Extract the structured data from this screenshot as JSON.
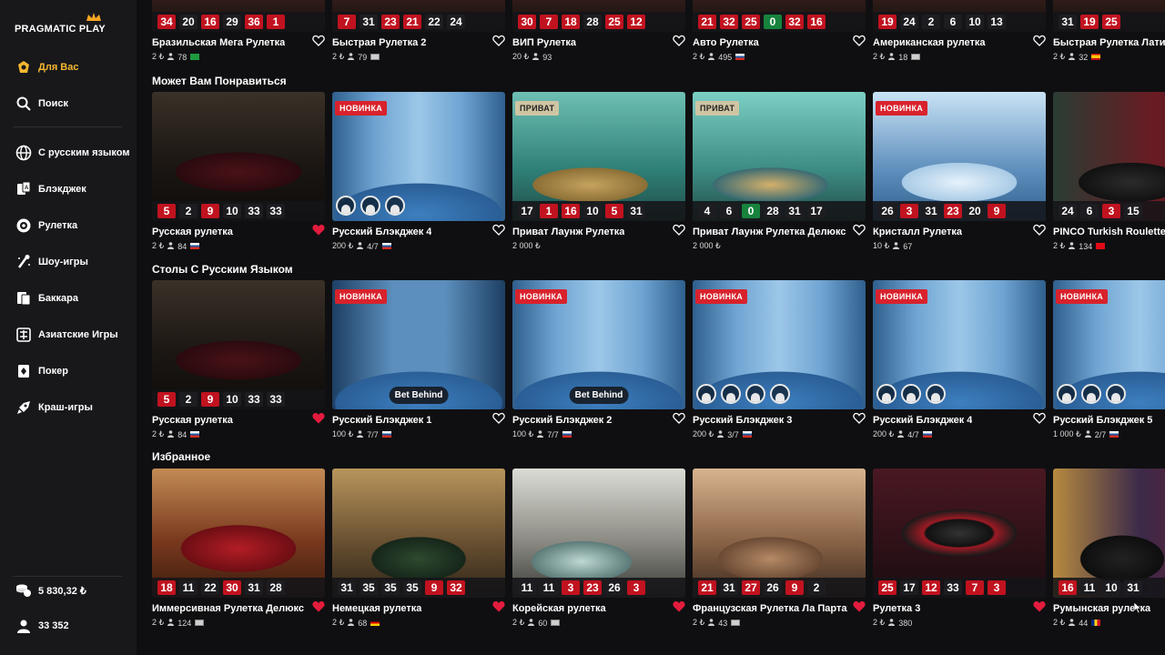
{
  "brand": {
    "logo_text": "PRAGMATIC PLAY"
  },
  "sidebar": {
    "items": [
      {
        "label": "Для Вас",
        "icon": "for-you-icon",
        "active": true
      },
      {
        "label": "Поиск",
        "icon": "search-icon"
      },
      {
        "label": "С русским языком",
        "icon": "globe-icon"
      },
      {
        "label": "Блэкджек",
        "icon": "blackjack-icon"
      },
      {
        "label": "Рулетка",
        "icon": "roulette-icon"
      },
      {
        "label": "Шоу-игры",
        "icon": "show-games-icon"
      },
      {
        "label": "Баккара",
        "icon": "baccarat-icon"
      },
      {
        "label": "Азиатские Игры",
        "icon": "asian-games-icon"
      },
      {
        "label": "Покер",
        "icon": "poker-icon"
      },
      {
        "label": "Краш-игры",
        "icon": "crash-games-icon"
      }
    ],
    "balance": "5 830,32 ₺",
    "players": "33 352"
  },
  "sections": [
    {
      "title": "",
      "cards": [
        {
          "name": "Бразильская Мега Рулетка",
          "bet": "2 ₺",
          "count": "78",
          "flag": "br",
          "nums": [
            [
              "34",
              "red"
            ],
            [
              "20",
              "blk"
            ],
            [
              "16",
              "red"
            ],
            [
              "29",
              "blk"
            ],
            [
              "36",
              "red"
            ],
            [
              "1",
              "red"
            ]
          ],
          "liked": false
        },
        {
          "name": "Быстрая Рулетка 2",
          "bet": "2 ₺",
          "count": "79",
          "flag": "gen",
          "nums": [
            [
              "7",
              "red"
            ],
            [
              "31",
              "blk"
            ],
            [
              "23",
              "red"
            ],
            [
              "21",
              "red"
            ],
            [
              "22",
              "blk"
            ],
            [
              "24",
              "blk"
            ]
          ],
          "liked": false
        },
        {
          "name": "ВИП Рулетка",
          "bet": "20 ₺",
          "count": "93",
          "flag": "",
          "nums": [
            [
              "30",
              "red"
            ],
            [
              "7",
              "red"
            ],
            [
              "18",
              "red"
            ],
            [
              "28",
              "blk"
            ],
            [
              "25",
              "red"
            ],
            [
              "12",
              "red"
            ]
          ],
          "liked": false
        },
        {
          "name": "Авто Рулетка",
          "bet": "2 ₺",
          "count": "495",
          "flag": "ru",
          "nums": [
            [
              "21",
              "red"
            ],
            [
              "32",
              "red"
            ],
            [
              "25",
              "red"
            ],
            [
              "0",
              "grn"
            ],
            [
              "32",
              "red"
            ],
            [
              "16",
              "red"
            ]
          ],
          "liked": false
        },
        {
          "name": "Американская рулетка",
          "bet": "2 ₺",
          "count": "18",
          "flag": "gen",
          "nums": [
            [
              "19",
              "red"
            ],
            [
              "24",
              "blk"
            ],
            [
              "2",
              "blk"
            ],
            [
              "6",
              "blk"
            ],
            [
              "10",
              "blk"
            ],
            [
              "13",
              "blk"
            ]
          ],
          "liked": false
        },
        {
          "name": "Быстрая Рулетка Латино",
          "bet": "2 ₺",
          "count": "32",
          "flag": "es",
          "nums": [
            [
              "31",
              "blk"
            ],
            [
              "19",
              "red"
            ],
            [
              "25",
              "red"
            ]
          ],
          "liked": false
        }
      ]
    },
    {
      "title": "Может Вам Понравиться",
      "cards": [
        {
          "name": "Русская рулетка",
          "bet": "2 ₺",
          "count": "84",
          "flag": "ru",
          "nums": [
            [
              "5",
              "red"
            ],
            [
              "2",
              "blk"
            ],
            [
              "9",
              "red"
            ],
            [
              "10",
              "blk"
            ],
            [
              "33",
              "blk"
            ],
            [
              "33",
              "blk"
            ]
          ],
          "liked": true,
          "scene": "roulette-dark"
        },
        {
          "name": "Русский Блэкджек 4",
          "bet": "200 ₺",
          "count": "4/7",
          "flag": "ru",
          "badge": "НОВИНКА",
          "seats": 3,
          "liked": false,
          "scene": "bj-blue"
        },
        {
          "name": "Приват Лаунж Рулетка",
          "bet": "2 000 ₺",
          "count": "",
          "flag": "",
          "badge_priv": "ПРИВАТ",
          "nums": [
            [
              "17",
              "blk"
            ],
            [
              "1",
              "red"
            ],
            [
              "16",
              "red"
            ],
            [
              "10",
              "blk"
            ],
            [
              "5",
              "red"
            ],
            [
              "31",
              "blk"
            ]
          ],
          "liked": false,
          "scene": "teal"
        },
        {
          "name": "Приват Лаунж Рулетка Делюкс",
          "bet": "2 000 ₺",
          "count": "",
          "flag": "",
          "badge_priv": "ПРИВАТ",
          "nums": [
            [
              "4",
              "blk"
            ],
            [
              "6",
              "blk"
            ],
            [
              "0",
              "grn"
            ],
            [
              "28",
              "blk"
            ],
            [
              "31",
              "blk"
            ],
            [
              "17",
              "blk"
            ]
          ],
          "liked": false,
          "scene": "teal2"
        },
        {
          "name": "Кристалл Рулетка",
          "bet": "10 ₺",
          "count": "67",
          "flag": "",
          "badge": "НОВИНКА",
          "nums": [
            [
              "26",
              "blk"
            ],
            [
              "3",
              "red"
            ],
            [
              "31",
              "blk"
            ],
            [
              "23",
              "red"
            ],
            [
              "20",
              "blk"
            ],
            [
              "9",
              "red"
            ]
          ],
          "liked": false,
          "scene": "crystal"
        },
        {
          "name": "PINCO Turkish Roulette",
          "bet": "2 ₺",
          "count": "134",
          "flag": "tr",
          "nums": [
            [
              "24",
              "blk"
            ],
            [
              "6",
              "blk"
            ],
            [
              "3",
              "red"
            ],
            [
              "15",
              "blk"
            ]
          ],
          "liked": false,
          "scene": "pinco"
        }
      ]
    },
    {
      "title": "Столы С Русским Языком",
      "cards": [
        {
          "name": "Русская рулетка",
          "bet": "2 ₺",
          "count": "84",
          "flag": "ru",
          "nums": [
            [
              "5",
              "red"
            ],
            [
              "2",
              "blk"
            ],
            [
              "9",
              "red"
            ],
            [
              "10",
              "blk"
            ],
            [
              "33",
              "blk"
            ],
            [
              "33",
              "blk"
            ]
          ],
          "liked": true,
          "scene": "roulette-dark"
        },
        {
          "name": "Русский Блэкджек 1",
          "bet": "100 ₺",
          "count": "7/7",
          "flag": "ru",
          "badge": "НОВИНКА",
          "betbehind": "Bet Behind",
          "liked": false,
          "scene": "bj-red"
        },
        {
          "name": "Русский Блэкджек 2",
          "bet": "100 ₺",
          "count": "7/7",
          "flag": "ru",
          "badge": "НОВИНКА",
          "betbehind": "Bet Behind",
          "liked": false,
          "scene": "bj-blue"
        },
        {
          "name": "Русский Блэкджек 3",
          "bet": "200 ₺",
          "count": "3/7",
          "flag": "ru",
          "badge": "НОВИНКА",
          "seats": 4,
          "liked": false,
          "scene": "bj-blue"
        },
        {
          "name": "Русский Блэкджек 4",
          "bet": "200 ₺",
          "count": "4/7",
          "flag": "ru",
          "badge": "НОВИНКА",
          "seats": 3,
          "liked": false,
          "scene": "bj-blue"
        },
        {
          "name": "Русский Блэкджек 5",
          "bet": "1 000 ₺",
          "count": "2/7",
          "flag": "ru",
          "badge": "НОВИНКА",
          "seats": 3,
          "liked": false,
          "scene": "bj-blue"
        }
      ]
    },
    {
      "title": "Избранное",
      "cards": [
        {
          "name": "Иммерсивная Рулетка Делюкс",
          "bet": "2 ₺",
          "count": "124",
          "flag": "gen",
          "nums": [
            [
              "18",
              "red"
            ],
            [
              "11",
              "blk"
            ],
            [
              "22",
              "blk"
            ],
            [
              "30",
              "red"
            ],
            [
              "31",
              "blk"
            ],
            [
              "28",
              "blk"
            ]
          ],
          "liked": true,
          "scene": "red-studio"
        },
        {
          "name": "Немецкая рулетка",
          "bet": "2 ₺",
          "count": "68",
          "flag": "de",
          "nums": [
            [
              "31",
              "blk"
            ],
            [
              "35",
              "blk"
            ],
            [
              "35",
              "blk"
            ],
            [
              "35",
              "blk"
            ],
            [
              "9",
              "red"
            ],
            [
              "32",
              "red"
            ]
          ],
          "liked": true,
          "scene": "gold"
        },
        {
          "name": "Корейская рулетка",
          "bet": "2 ₺",
          "count": "60",
          "flag": "gen",
          "nums": [
            [
              "11",
              "blk"
            ],
            [
              "11",
              "blk"
            ],
            [
              "3",
              "red"
            ],
            [
              "23",
              "red"
            ],
            [
              "26",
              "blk"
            ],
            [
              "3",
              "red"
            ]
          ],
          "liked": true,
          "scene": "silver"
        },
        {
          "name": "Французская Рулетка Ла Партаж",
          "bet": "2 ₺",
          "count": "43",
          "flag": "gen",
          "nums": [
            [
              "21",
              "red"
            ],
            [
              "31",
              "blk"
            ],
            [
              "27",
              "red"
            ],
            [
              "26",
              "blk"
            ],
            [
              "9",
              "red"
            ],
            [
              "2",
              "blk"
            ]
          ],
          "liked": true,
          "scene": "bronze"
        },
        {
          "name": "Рулетка 3",
          "bet": "2 ₺",
          "count": "380",
          "flag": "",
          "nums": [
            [
              "25",
              "red"
            ],
            [
              "17",
              "blk"
            ],
            [
              "12",
              "red"
            ],
            [
              "33",
              "blk"
            ],
            [
              "7",
              "red"
            ],
            [
              "3",
              "red"
            ]
          ],
          "liked": true,
          "scene": "dark-wheel"
        },
        {
          "name": "Румынская рулетка",
          "bet": "2 ₺",
          "count": "44",
          "flag": "ro",
          "nums": [
            [
              "16",
              "red"
            ],
            [
              "11",
              "blk"
            ],
            [
              "10",
              "blk"
            ],
            [
              "31",
              "blk"
            ]
          ],
          "liked": false,
          "scene": "ro"
        }
      ]
    }
  ],
  "colors": {
    "accent": "#f5b731",
    "new_badge": "#d8222c",
    "heart": "#e31c3d",
    "sidebar_bg": "#18181b",
    "page_bg": "#0f0f11"
  }
}
